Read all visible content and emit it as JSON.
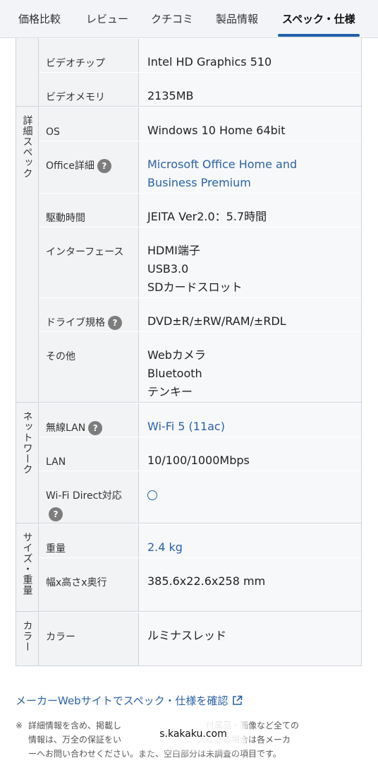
{
  "tabs": [
    "価格比較",
    "レビュー",
    "クチコミ",
    "製品情報",
    "スペック・仕様"
  ],
  "groups": [
    {
      "category": "",
      "rows": [
        {
          "label": "ビデオチップ",
          "value": [
            "Intel HD Graphics 510"
          ]
        },
        {
          "label": "ビデオメモリ",
          "value": [
            "2135MB"
          ]
        }
      ]
    },
    {
      "category": "詳細スペック",
      "rows": [
        {
          "label": "OS",
          "value": [
            "Windows 10 Home 64bit"
          ]
        },
        {
          "label": "Office詳細",
          "help": true,
          "link": true,
          "value": [
            "Microsoft Office Home and",
            "Business Premium"
          ]
        },
        {
          "label": "駆動時間",
          "value": [
            "JEITA Ver2.0：5.7時間"
          ]
        },
        {
          "label": "インターフェース",
          "value": [
            "HDMI端子",
            "USB3.0",
            "SDカードスロット"
          ]
        },
        {
          "label": "ドライブ規格",
          "help": true,
          "value": [
            "DVD±R/±RW/RAM/±RDL"
          ]
        },
        {
          "label": "その他",
          "value": [
            "Webカメラ",
            "Bluetooth",
            "テンキー"
          ]
        }
      ]
    },
    {
      "category": "ネットワーク",
      "rows": [
        {
          "label": "無線LAN",
          "help": true,
          "link": true,
          "value": [
            "Wi-Fi 5 (11ac)"
          ]
        },
        {
          "label": "LAN",
          "value": [
            "10/100/1000Mbps"
          ]
        },
        {
          "label": "Wi-Fi Direct対応",
          "help": true,
          "circle": true,
          "value": [
            "○"
          ]
        }
      ]
    },
    {
      "category": "サイズ・重量",
      "rows": [
        {
          "label": "重量",
          "link": true,
          "value": [
            "2.4 kg"
          ]
        },
        {
          "label": "幅x高さx奥行",
          "value": [
            "385.6x22.6x258 mm"
          ]
        }
      ]
    },
    {
      "category": "カラー",
      "rows": [
        {
          "label": "カラー",
          "value": [
            "ルミナスレッド"
          ]
        }
      ]
    }
  ],
  "footer": {
    "maker_link": "メーカーWebサイトでスペック・仕様を確認",
    "note_mark": "※",
    "note_lines": [
      "詳細情報を含め、掲載し　　　　　　　　　　付属品・画像など全ての",
      "情報は、万全の保証をい　　　　　　　　　入なさる場合は各メーカ",
      "ーへお問い合わせください。また、空白部分は未調査の項目です。"
    ],
    "watermark": "s.kakaku.com"
  },
  "colors": {
    "accent": "#1f5fa8",
    "link": "#2b62a8",
    "label_bg": "#f2f3f5"
  }
}
